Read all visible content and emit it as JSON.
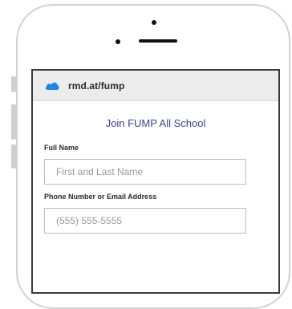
{
  "browser": {
    "url": "rmd.at/fump",
    "icon": "cloud-icon",
    "icon_color": "#1f86e6"
  },
  "form": {
    "title": "Join FUMP All School",
    "title_color": "#3a3f94",
    "fields": [
      {
        "label": "Full Name",
        "placeholder": "First and Last Name"
      },
      {
        "label": "Phone Number or Email Address",
        "placeholder": "(555) 555-5555"
      }
    ]
  }
}
